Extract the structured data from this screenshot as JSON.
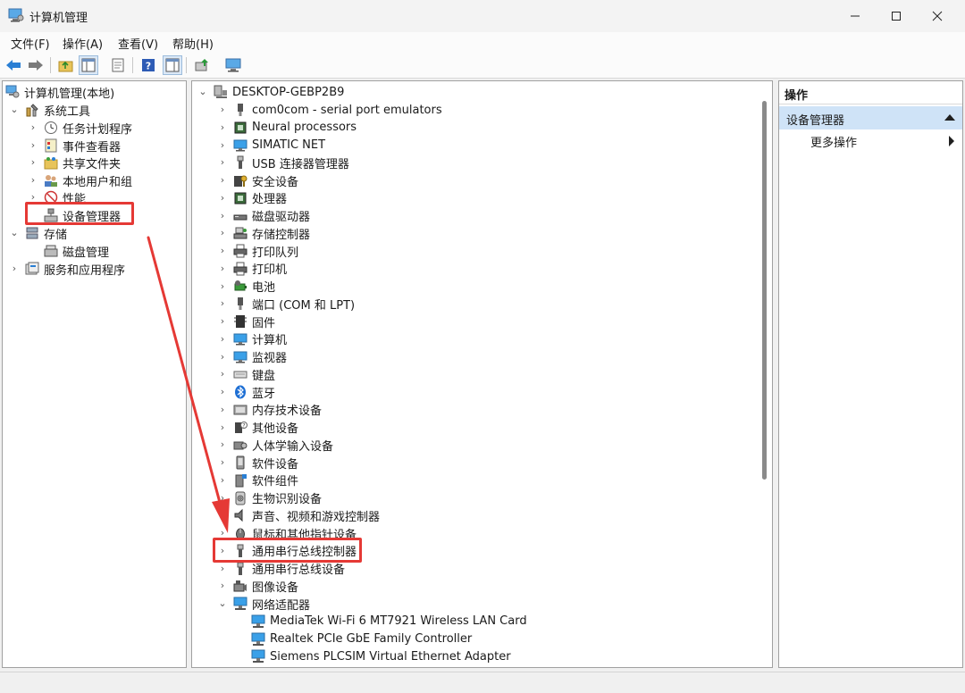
{
  "window": {
    "title": "计算机管理"
  },
  "menu": [
    "文件(F)",
    "操作(A)",
    "查看(V)",
    "帮助(H)"
  ],
  "colors": {
    "accent": "#0078d4",
    "annotation": "#e53935",
    "selection": "#cce4f7"
  },
  "left_tree": [
    {
      "label": "计算机管理(本地)",
      "icon": "computer-management-icon",
      "depth": 0,
      "chev": ""
    },
    {
      "label": "系统工具",
      "icon": "tools-icon",
      "depth": 0,
      "chev": "open"
    },
    {
      "label": "任务计划程序",
      "icon": "clock-icon",
      "depth": 1,
      "chev": "closed"
    },
    {
      "label": "事件查看器",
      "icon": "event-viewer-icon",
      "depth": 1,
      "chev": "closed"
    },
    {
      "label": "共享文件夹",
      "icon": "shared-folder-icon",
      "depth": 1,
      "chev": "closed"
    },
    {
      "label": "本地用户和组",
      "icon": "users-icon",
      "depth": 1,
      "chev": "closed"
    },
    {
      "label": "性能",
      "icon": "performance-icon",
      "depth": 1,
      "chev": "closed"
    },
    {
      "label": "设备管理器",
      "icon": "device-manager-icon",
      "depth": 1,
      "chev": ""
    },
    {
      "label": "存储",
      "icon": "storage-icon",
      "depth": 0,
      "chev": "open"
    },
    {
      "label": "磁盘管理",
      "icon": "disk-management-icon",
      "depth": 1,
      "chev": ""
    },
    {
      "label": "服务和应用程序",
      "icon": "services-icon",
      "depth": 0,
      "chev": "closed"
    }
  ],
  "device_tree": {
    "root": "DESKTOP-GEBP2B9",
    "items": [
      {
        "label": "com0com - serial port emulators",
        "icon": "port-icon",
        "chev": "closed"
      },
      {
        "label": "Neural processors",
        "icon": "chip-icon",
        "chev": "closed"
      },
      {
        "label": "SIMATIC NET",
        "icon": "monitor-icon",
        "chev": "closed"
      },
      {
        "label": "USB 连接器管理器",
        "icon": "usb-icon",
        "chev": "closed"
      },
      {
        "label": "安全设备",
        "icon": "security-key-icon",
        "chev": "closed"
      },
      {
        "label": "处理器",
        "icon": "chip-icon",
        "chev": "closed"
      },
      {
        "label": "磁盘驱动器",
        "icon": "disk-drive-icon",
        "chev": "closed"
      },
      {
        "label": "存储控制器",
        "icon": "storage-controller-icon",
        "chev": "closed"
      },
      {
        "label": "打印队列",
        "icon": "printer-icon",
        "chev": "closed"
      },
      {
        "label": "打印机",
        "icon": "printer-icon",
        "chev": "closed"
      },
      {
        "label": "电池",
        "icon": "battery-icon",
        "chev": "closed"
      },
      {
        "label": "端口 (COM 和 LPT)",
        "icon": "port-icon",
        "chev": "closed"
      },
      {
        "label": "固件",
        "icon": "firmware-icon",
        "chev": "closed"
      },
      {
        "label": "计算机",
        "icon": "monitor-icon",
        "chev": "closed"
      },
      {
        "label": "监视器",
        "icon": "monitor-icon",
        "chev": "closed"
      },
      {
        "label": "键盘",
        "icon": "keyboard-icon",
        "chev": "closed"
      },
      {
        "label": "蓝牙",
        "icon": "bluetooth-icon",
        "chev": "closed"
      },
      {
        "label": "内存技术设备",
        "icon": "memory-icon",
        "chev": "closed"
      },
      {
        "label": "其他设备",
        "icon": "unknown-device-icon",
        "chev": "closed"
      },
      {
        "label": "人体学输入设备",
        "icon": "hid-icon",
        "chev": "closed"
      },
      {
        "label": "软件设备",
        "icon": "software-device-icon",
        "chev": "closed"
      },
      {
        "label": "软件组件",
        "icon": "software-component-icon",
        "chev": "closed"
      },
      {
        "label": "生物识别设备",
        "icon": "fingerprint-icon",
        "chev": "closed"
      },
      {
        "label": "声音、视频和游戏控制器",
        "icon": "speaker-icon",
        "chev": "closed"
      },
      {
        "label": "鼠标和其他指针设备",
        "icon": "mouse-icon",
        "chev": "closed"
      },
      {
        "label": "通用串行总线控制器",
        "icon": "usb-icon",
        "chev": "closed"
      },
      {
        "label": "通用串行总线设备",
        "icon": "usb-icon",
        "chev": "closed"
      },
      {
        "label": "图像设备",
        "icon": "camera-icon",
        "chev": "closed"
      },
      {
        "label": "网络适配器",
        "icon": "network-icon",
        "chev": "open"
      }
    ],
    "network_children": [
      "MediaTek Wi-Fi 6 MT7921 Wireless LAN Card",
      "Realtek PCIe GbE Family Controller",
      "Siemens PLCSIM Virtual Ethernet Adapter"
    ]
  },
  "actions": {
    "header": "操作",
    "section": "设备管理器",
    "item": "更多操作"
  }
}
